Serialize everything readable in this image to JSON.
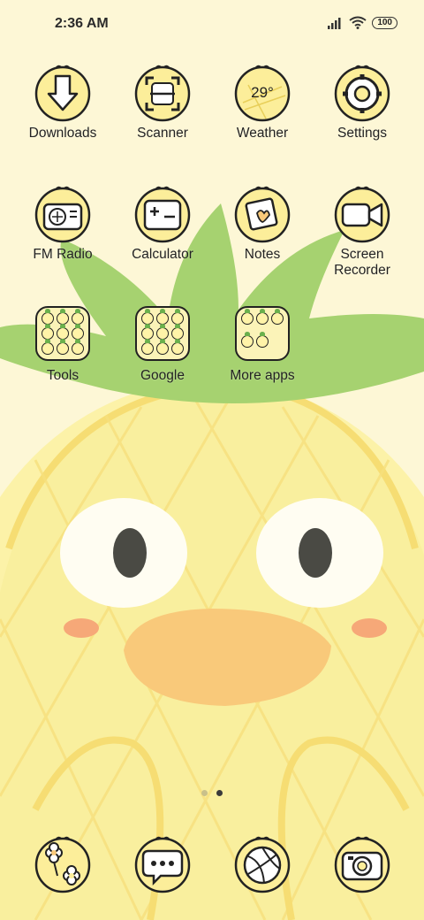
{
  "status_bar": {
    "time": "2:36 AM",
    "battery": "100"
  },
  "apps": [
    {
      "label": "Downloads",
      "icon": "download-arrow-icon"
    },
    {
      "label": "Scanner",
      "icon": "scanner-icon"
    },
    {
      "label": "Weather",
      "icon": "weather-icon",
      "value": "29°"
    },
    {
      "label": "Settings",
      "icon": "gear-icon"
    },
    {
      "label": "FM Radio",
      "icon": "radio-icon"
    },
    {
      "label": "Calculator",
      "icon": "calculator-icon"
    },
    {
      "label": "Notes",
      "icon": "notes-icon"
    },
    {
      "label": "Screen\nRecorder",
      "icon": "video-camera-icon"
    }
  ],
  "folders": [
    {
      "label": "Tools",
      "count": 9
    },
    {
      "label": "Google",
      "count": 9
    },
    {
      "label": "More apps",
      "count": 5
    }
  ],
  "dock": [
    {
      "icon": "gallery-flower-icon"
    },
    {
      "icon": "messages-chat-icon"
    },
    {
      "icon": "browser-ball-icon"
    },
    {
      "icon": "camera-icon"
    }
  ],
  "page_indicator": {
    "pages": 2,
    "current": 2
  },
  "colors": {
    "background": "#fdf7d6",
    "pineapple_body": "#f9ef9e",
    "leaves": "#a6d270",
    "beak": "#f9c97a",
    "cheek": "#f6a878",
    "icon_fill": "#fcee9a",
    "icon_leaf": "#6ab04c"
  }
}
